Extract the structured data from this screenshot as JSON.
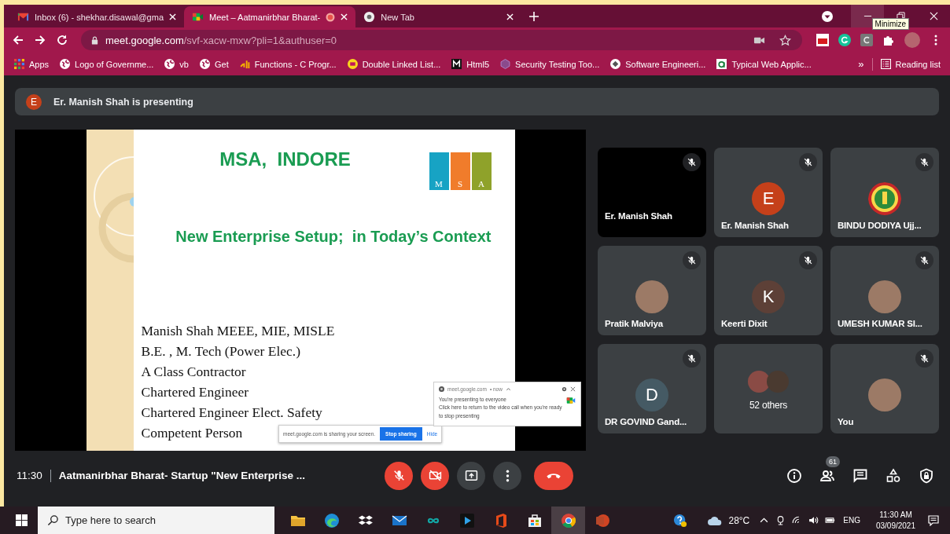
{
  "browser": {
    "tabs": [
      {
        "title": "Inbox (6) - shekhar.disawal@gma",
        "kind": "mail",
        "selected": false,
        "recording": false
      },
      {
        "title": "Meet – Aatmanirbhar Bharat-",
        "kind": "meet",
        "selected": true,
        "recording": true
      },
      {
        "title": "New Tab",
        "kind": "chrome",
        "selected": false,
        "recording": false
      }
    ],
    "tooltip": "Minimize",
    "address": {
      "host": "meet.google.com",
      "path": "/svf-xacw-mxw?pli=1&authuser=0"
    },
    "bookmarks": [
      {
        "label": "Apps",
        "kind": "apps"
      },
      {
        "label": "Logo of Governme...",
        "kind": "globe"
      },
      {
        "label": "vb",
        "kind": "globe"
      },
      {
        "label": "Get",
        "kind": "globe"
      },
      {
        "label": "Functions - C Progr...",
        "kind": "fn"
      },
      {
        "label": "Double Linked List...",
        "kind": "badge"
      },
      {
        "label": "Html5",
        "kind": "square"
      },
      {
        "label": "Security Testing Too...",
        "kind": "hex"
      },
      {
        "label": "Software Engineeri...",
        "kind": "disc"
      },
      {
        "label": "Typical Web Applic...",
        "kind": "leaf"
      }
    ],
    "more": "»",
    "reading_list": "Reading list"
  },
  "meet": {
    "presenter": {
      "initial": "E",
      "color": "#c5401a",
      "text": "Er. Manish Shah is presenting"
    },
    "slide": {
      "title": "MSA,  INDORE",
      "logo": [
        {
          "letter": "M",
          "color": "#17a3c4"
        },
        {
          "letter": "S",
          "color": "#f07c2b"
        },
        {
          "letter": "A",
          "color": "#8fa22a"
        }
      ],
      "subtitle": "New Enterprise Setup;  in Today’s Context",
      "lines": [
        "Manish Shah MEEE, MIE, MISLE",
        "B.E. , M. Tech (Power Elec.)",
        "A Class Contractor",
        "Chartered Engineer",
        "Chartered Engineer Elect. Safety",
        "Competent Person"
      ]
    },
    "share_bar": {
      "text": "meet.google.com is sharing your screen.",
      "stop": "Stop sharing",
      "hide": "Hide"
    },
    "notification": {
      "source": "meet.google.com",
      "time": "• now",
      "title": "You're presenting to everyone",
      "body": "Click here to return to the video call when you're ready to stop presenting"
    },
    "tiles": [
      {
        "name": "Er. Manish Shah",
        "kind": "video",
        "muted": true
      },
      {
        "name": "Er. Manish Shah",
        "kind": "initial",
        "initial": "E",
        "color": "#c5401a",
        "muted": true
      },
      {
        "name": "BINDU DODIYA Ujj...",
        "kind": "emblem",
        "muted": true
      },
      {
        "name": "Pratik Malviya",
        "kind": "photo",
        "muted": true
      },
      {
        "name": "Keerti Dixit",
        "kind": "initial",
        "initial": "K",
        "color": "#5d4037",
        "muted": true
      },
      {
        "name": "UMESH KUMAR SI...",
        "kind": "photo",
        "muted": true
      },
      {
        "name": "DR GOVIND Gand...",
        "kind": "initial",
        "initial": "D",
        "color": "#455a64",
        "muted": true
      },
      {
        "name": "52 others",
        "kind": "group",
        "muted": false
      },
      {
        "name": "You",
        "kind": "photo",
        "muted": true
      }
    ],
    "time": "11:30",
    "meeting_title": "Aatmanirbhar Bharat- Startup \"New Enterprise ...",
    "controls": [
      {
        "kind": "mic",
        "on": false
      },
      {
        "kind": "camera",
        "on": false
      },
      {
        "kind": "present"
      },
      {
        "kind": "more"
      },
      {
        "kind": "hangup"
      }
    ],
    "tools": [
      {
        "kind": "info"
      },
      {
        "kind": "people",
        "badge": "61"
      },
      {
        "kind": "chat"
      },
      {
        "kind": "activities"
      },
      {
        "kind": "host"
      }
    ]
  },
  "taskbar": {
    "search": {
      "placeholder": "Type here to search"
    },
    "apps": [
      {
        "kind": "folder",
        "selected": false
      },
      {
        "kind": "edge",
        "selected": false
      },
      {
        "kind": "dropbox",
        "selected": false
      },
      {
        "kind": "mail",
        "selected": false
      },
      {
        "kind": "infinity",
        "selected": false
      },
      {
        "kind": "player",
        "selected": false
      },
      {
        "kind": "office",
        "selected": false
      },
      {
        "kind": "store",
        "selected": false
      },
      {
        "kind": "chrome",
        "selected": true
      },
      {
        "kind": "slides",
        "selected": false
      }
    ],
    "temperature": "28°C",
    "language": "ENG",
    "time": "11:30 AM",
    "date": "03/09/2021"
  }
}
